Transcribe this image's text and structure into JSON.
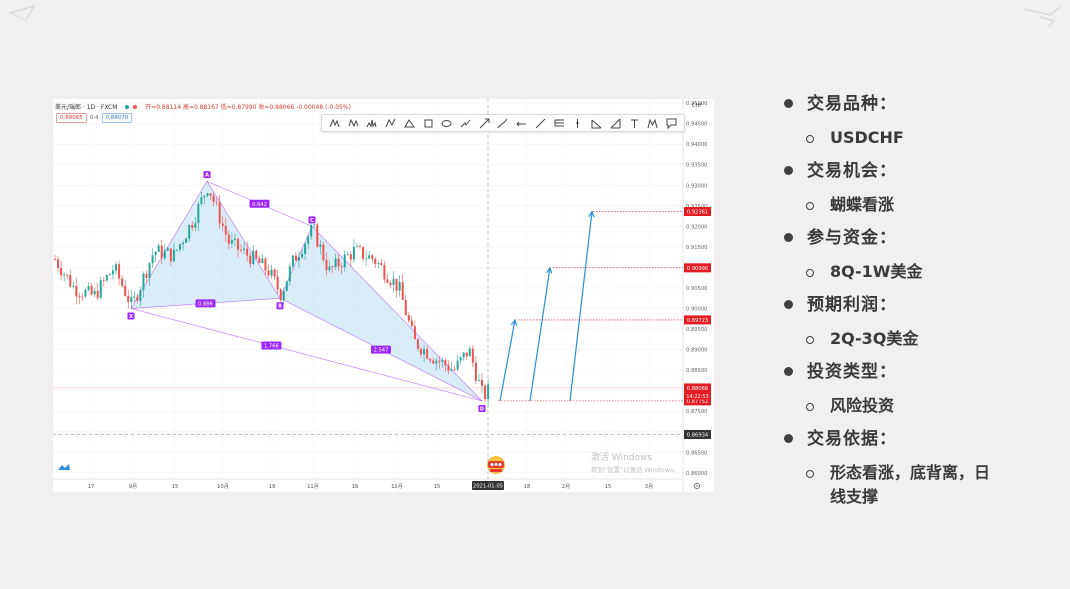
{
  "chart_header": {
    "symbol": "美元/瑞郎 · 1D · FXCM",
    "ohlc": "开=0.88114 高=0.88167 低=0.87990 收=0.88066 -0.00048 (-0.05%)",
    "sell_price": "0.88065",
    "spread": "0.4",
    "buy_price": "0.88070",
    "currency": "CHF"
  },
  "toolbar_tools": [
    "xabcd-pattern-icon",
    "cypher-pattern-icon",
    "head-shoulders-icon",
    "abcd-pattern-icon",
    "triangle-pattern-icon",
    "rectangle-icon",
    "ellipse-icon",
    "path-icon",
    "arrow-icon",
    "brush-icon",
    "ray-icon",
    "trend-line-icon",
    "pitchfork-icon",
    "vertical-line-icon",
    "fib-icon",
    "measure-icon",
    "text-icon",
    "anchored-text-icon",
    "note-icon"
  ],
  "chart_data": {
    "type": "candlestick",
    "title": "",
    "xlabel": "",
    "ylabel": "",
    "x_ticks": [
      "17",
      "9月",
      "15",
      "10月",
      "19",
      "11月",
      "16",
      "12月",
      "15",
      "2021-01-05",
      "18",
      "2月",
      "15",
      "3月"
    ],
    "y_ticks": [
      "0.95000",
      "0.94500",
      "0.94000",
      "0.93500",
      "0.93000",
      "0.92500",
      "0.92000",
      "0.91500",
      "0.91000",
      "0.90500",
      "0.90000",
      "0.89500",
      "0.89000",
      "0.88500",
      "0.88000",
      "0.87500",
      "0.87000",
      "0.86500",
      "0.86000"
    ],
    "ylim": [
      0.8585,
      0.951
    ],
    "price_labels": [
      {
        "value": 0.92361,
        "text": "0.92361",
        "color": "#e31b23"
      },
      {
        "value": 0.9099,
        "text": "0.90990",
        "color": "#e31b23"
      },
      {
        "value": 0.89723,
        "text": "0.89723",
        "color": "#e31b23"
      },
      {
        "value": 0.88066,
        "text": "0.88066",
        "color": "#e31b23"
      },
      {
        "value": 0.87752,
        "text": "0.87752",
        "color": "#e31b23"
      },
      {
        "value": 0.86934,
        "text": "0.86934",
        "color": "#333333"
      }
    ],
    "countdown": "14:22:53",
    "crosshair_date": "2021-01-05",
    "harmonic_pattern": {
      "points": [
        {
          "label": "X",
          "value": 0.9
        },
        {
          "label": "A",
          "value": 0.931
        },
        {
          "label": "B",
          "value": 0.9025
        },
        {
          "label": "C",
          "value": 0.92
        },
        {
          "label": "D",
          "value": 0.8775
        }
      ],
      "ratios": [
        "0.642",
        "0.886",
        "1.766",
        "2.547"
      ]
    },
    "projection_arrows": [
      {
        "from": 0.8775,
        "to": 0.8972
      },
      {
        "from": 0.8775,
        "to": 0.9099
      },
      {
        "from": 0.8775,
        "to": 0.9236
      }
    ]
  },
  "watermark": {
    "line1": "激活 Windows",
    "line2": "转到\"设置\"以激活 Windows。"
  },
  "bullets": [
    {
      "title": "交易品种：",
      "sub": "USDCHF"
    },
    {
      "title": "交易机会：",
      "sub": "蝴蝶看涨"
    },
    {
      "title": "参与资金：",
      "sub": "8Q-1W美金"
    },
    {
      "title": "预期利润：",
      "sub": "2Q-3Q美金"
    },
    {
      "title": "投资类型：",
      "sub": "风险投资"
    },
    {
      "title": "交易依据：",
      "sub": "形态看涨，底背离，日线支撑"
    }
  ],
  "colors": {
    "up": "#26a69a",
    "down": "#ef5350",
    "pattern": "#9c27ff",
    "pattern_fill": "#cfe6f7",
    "arrow": "#2a8fd8",
    "price_tag": "#e31b23"
  }
}
